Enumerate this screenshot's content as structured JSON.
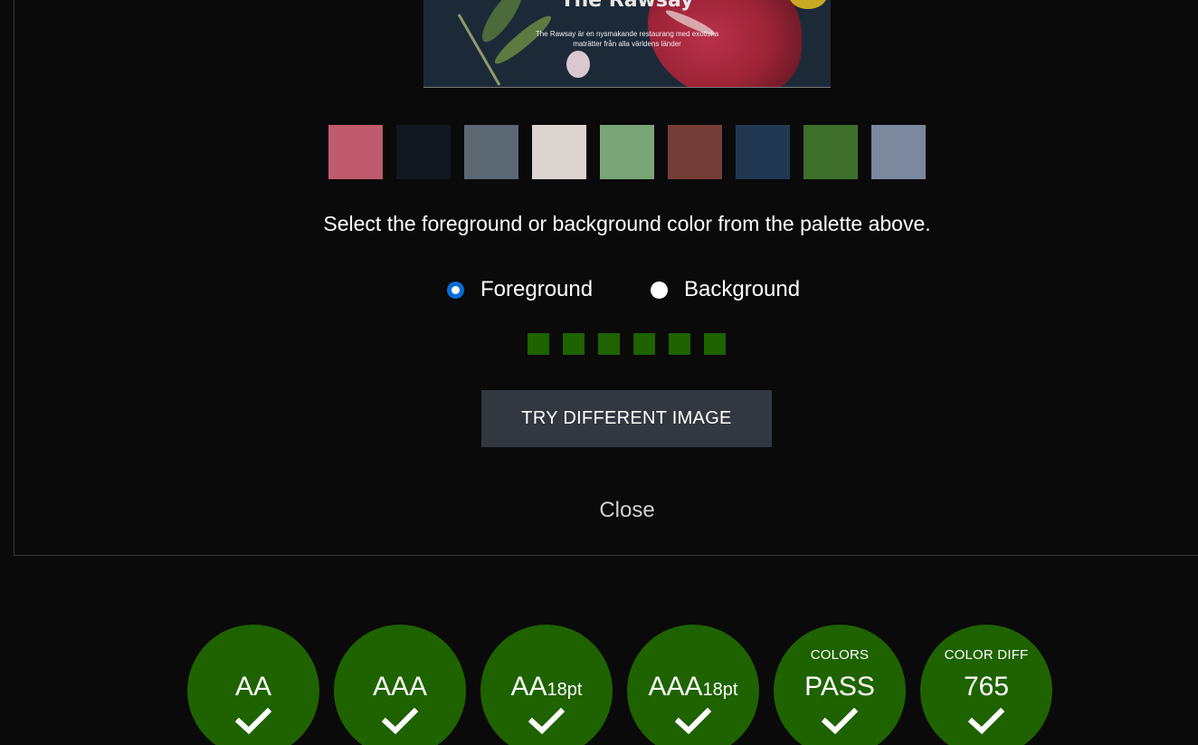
{
  "preview": {
    "title": "The Rawsay",
    "subtitle": "The Rawsay är en nysmakande restaurang med exotiska maträtter från alla världens länder"
  },
  "palette": [
    "#c05a6e",
    "#111820",
    "#5b6771",
    "#dcd4d0",
    "#7aa577",
    "#763e38",
    "#213752",
    "#3d6e2a",
    "#7b889e"
  ],
  "instruction": "Select the foreground or background color from the palette above.",
  "radios": {
    "foreground_label": "Foreground",
    "background_label": "Background",
    "selected": "Foreground"
  },
  "dots_color": "#1e6300",
  "try_button": "TRY DIFFERENT IMAGE",
  "close_label": "Close",
  "badges": [
    {
      "top": "",
      "main": "AA",
      "sub": "",
      "status": "pass"
    },
    {
      "top": "",
      "main": "AAA",
      "sub": "",
      "status": "pass"
    },
    {
      "top": "",
      "main": "AA",
      "sub": "18pt",
      "status": "pass"
    },
    {
      "top": "",
      "main": "AAA",
      "sub": "18pt",
      "status": "pass"
    },
    {
      "top": "COLORS",
      "main": "PASS",
      "sub": "",
      "status": "pass"
    },
    {
      "top": "COLOR DIFF",
      "main": "765",
      "sub": "",
      "status": "pass"
    }
  ],
  "colors": {
    "badge_bg": "#1e6300",
    "button_bg": "#323740",
    "radio_selected": "#0a6cd6"
  }
}
